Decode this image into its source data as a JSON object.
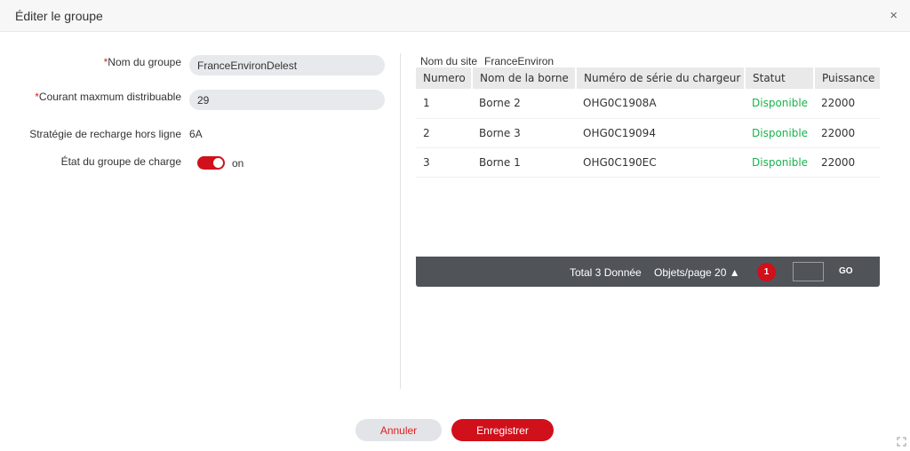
{
  "dialog": {
    "title": "Éditer le groupe",
    "close_icon": "×"
  },
  "form": {
    "group_name": {
      "required_mark": "*",
      "label": "Nom du groupe",
      "value": "FranceEnvironDelest"
    },
    "max_current": {
      "required_mark": "*",
      "label": "Courant maxmum distribuable",
      "value": "29"
    },
    "offline_strategy": {
      "label": "Stratégie de recharge hors ligne",
      "value": "6A"
    },
    "group_state": {
      "label": "État du groupe de charge",
      "toggle_state": "on"
    }
  },
  "site": {
    "label": "Nom du site",
    "value": "FranceEnviron"
  },
  "table": {
    "headers": [
      "Numero",
      "Nom de la borne",
      "Numéro de série du chargeur",
      "Statut",
      "Puissance"
    ],
    "rows": [
      [
        "1",
        "Borne 2",
        "OHG0C1908A",
        "Disponible",
        "22000"
      ],
      [
        "2",
        "Borne 3",
        "OHG0C19094",
        "Disponible",
        "22000"
      ],
      [
        "3",
        "Borne 1",
        "OHG0C190EC",
        "Disponible",
        "22000"
      ]
    ],
    "status_color": "#19b24b"
  },
  "pagination": {
    "total": "Total 3 Donnée",
    "per_page": "Objets/page 20 ▲",
    "current_page": "1",
    "go_label": "GO"
  },
  "footer": {
    "cancel_label": "Annuler",
    "save_label": "Enregistrer"
  },
  "colors": {
    "accent": "#d0101a",
    "pager_bg": "#505459"
  }
}
